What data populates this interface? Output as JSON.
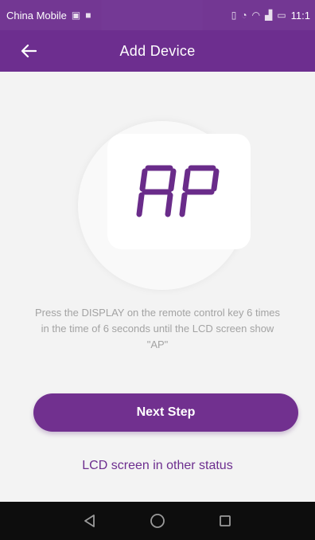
{
  "status_bar": {
    "carrier": "China Mobile",
    "time": "11:1"
  },
  "app_bar": {
    "title": "Add Device",
    "back_icon": "arrow-left-icon"
  },
  "illustration": {
    "lcd_text": "AP",
    "lcd_color": "#6a2c8a"
  },
  "instruction": "Press the DISPLAY on the remote control key 6 times in the time of 6 seconds until the LCD screen show \"AP\"",
  "buttons": {
    "next_step": "Next Step",
    "other_status": "LCD screen in other status"
  },
  "nav_bar": {
    "icons": [
      "back-triangle-icon",
      "home-circle-icon",
      "recents-square-icon"
    ]
  },
  "colors": {
    "brand": "#6d2e8f",
    "background": "#f3f3f3",
    "instruction_text": "#a3a3a3"
  }
}
